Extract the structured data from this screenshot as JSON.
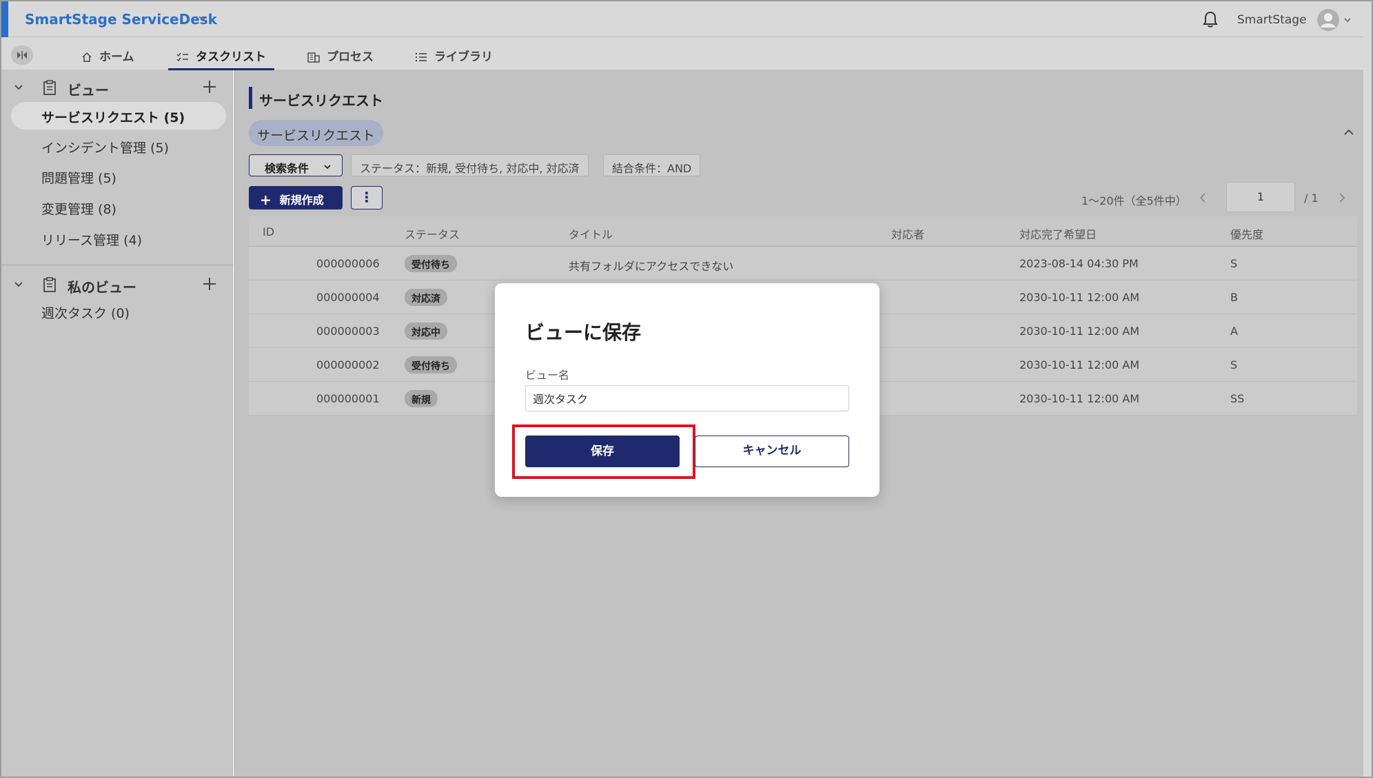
{
  "header": {
    "app_title": "SmartStage ServiceDesk",
    "user_name": "SmartStage"
  },
  "tabs": [
    {
      "label": "ホーム",
      "icon": "home-icon"
    },
    {
      "label": "タスクリスト",
      "icon": "checklist-icon",
      "active": true
    },
    {
      "label": "プロセス",
      "icon": "building-icon"
    },
    {
      "label": "ライブラリ",
      "icon": "list-icon"
    }
  ],
  "sidebar": {
    "views": {
      "label": "ビュー",
      "items": [
        {
          "label": "サービスリクエスト (5)",
          "selected": true
        },
        {
          "label": "インシデント管理 (5)"
        },
        {
          "label": "問題管理 (5)"
        },
        {
          "label": "変更管理 (8)"
        },
        {
          "label": "リリース管理 (4)"
        }
      ]
    },
    "my_views": {
      "label": "私のビュー",
      "items": [
        {
          "label": "週次タスク (0)"
        }
      ]
    }
  },
  "main": {
    "page_title": "サービスリクエスト",
    "view_chip": "サービスリクエスト",
    "search_button": "検索条件",
    "status_condition": "ステータス：新規, 受付待ち, 対応中, 対応済",
    "join_condition": "結合条件：AND",
    "new_button": "新規作成",
    "more_button": "⋮",
    "pager": {
      "count": "1～20件（全5件中）",
      "page": "1",
      "total": "/ 1"
    }
  },
  "table": {
    "headers": [
      "ID",
      "ステータス",
      "タイトル",
      "対応者",
      "対応完了希望日",
      "優先度"
    ],
    "rows": [
      {
        "id": "000000006",
        "status": "受付待ち",
        "title": "共有フォルダにアクセスできない",
        "assignee": "",
        "due": "2023-08-14 04:30 PM",
        "priority": "S"
      },
      {
        "id": "000000004",
        "status": "対応済",
        "title": "",
        "assignee": "",
        "due": "2030-10-11 12:00 AM",
        "priority": "B"
      },
      {
        "id": "000000003",
        "status": "対応中",
        "title": "",
        "assignee": "",
        "due": "2030-10-11 12:00 AM",
        "priority": "A"
      },
      {
        "id": "000000002",
        "status": "受付待ち",
        "title": "",
        "assignee": "",
        "due": "2030-10-11 12:00 AM",
        "priority": "S"
      },
      {
        "id": "000000001",
        "status": "新規",
        "title": "",
        "assignee": "",
        "due": "2030-10-11 12:00 AM",
        "priority": "SS"
      }
    ]
  },
  "modal": {
    "title": "ビューに保存",
    "field_label": "ビュー名",
    "field_value": "週次タスク",
    "save_label": "保存",
    "cancel_label": "キャンセル"
  },
  "colors": {
    "brand": "#2a6fc9",
    "primary": "#1f2a6e",
    "highlight": "#e0121c"
  }
}
